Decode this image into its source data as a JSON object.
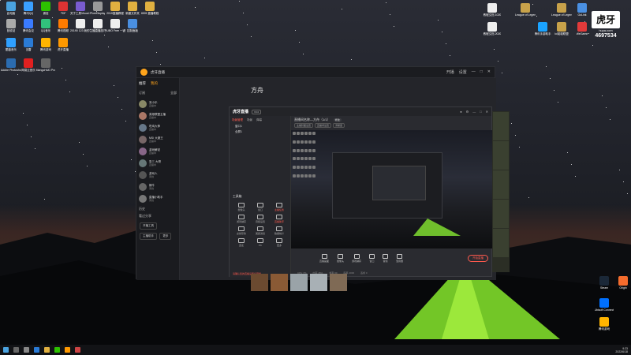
{
  "overlay": {
    "logo": "虎牙",
    "sub": "huya.com",
    "room_number": "4697534"
  },
  "desktop_left_icons": [
    {
      "label": "此电脑",
      "color": "#4aa3e0"
    },
    {
      "label": "腾讯QQ",
      "color": "#3aa0ff"
    },
    {
      "label": "微信",
      "color": "#2dc100"
    },
    {
      "label": "PDF",
      "color": "#d33"
    },
    {
      "label": "关于工具Visual Studio",
      "color": "#7a5cd0"
    },
    {
      "label": "PureDisplay",
      "color": "#999"
    },
    {
      "label": "2019直播教程",
      "color": "#e0b040"
    },
    {
      "label": "新建文件夹",
      "color": "#e0b040"
    },
    {
      "label": "4595 直播教程",
      "color": "#e0b040"
    },
    {
      "label": "回收站",
      "color": "#aaa"
    },
    {
      "label": "腾讯会议",
      "color": "#3a7bff"
    },
    {
      "label": "QQ音乐",
      "color": "#31c27c"
    },
    {
      "label": "腾讯视频",
      "color": "#ff7b00"
    },
    {
      "label": "20190 123 我的下载",
      "color": "#eee"
    },
    {
      "label": "主播直播技巧",
      "color": "#eee"
    },
    {
      "label": "YUBO Free 一键换",
      "color": "#eee"
    },
    {
      "label": "控制面板",
      "color": "#4a8fe0"
    },
    {
      "label": "酷狗音乐",
      "color": "#2fa0ff"
    },
    {
      "label": "迅雷",
      "color": "#2a7bd6"
    },
    {
      "label": "腾讯游戏",
      "color": "#ffb400"
    },
    {
      "label": "虎牙直播",
      "color": "#ff9900"
    },
    {
      "label": "Adobe Photoshop",
      "color": "#2b6cb0"
    },
    {
      "label": "网易云音乐",
      "color": "#e02020"
    },
    {
      "label": "MangoHUD Pro",
      "color": "#666"
    }
  ],
  "desktop_right_icons": [
    {
      "label": "教程文档 1020",
      "color": "#eee"
    },
    {
      "label": "League of Legends",
      "color": "#c8a24a"
    },
    {
      "label": "League of Legends",
      "color": "#c8a24a"
    },
    {
      "label": "GoLink",
      "color": "#4a90e2"
    },
    {
      "label": "教程文档 2020",
      "color": "#eee"
    },
    {
      "label": "腾讯手游助手",
      "color": "#1aa3ff"
    },
    {
      "label": "lol英雄联盟",
      "color": "#c8a24a"
    },
    {
      "label": "WeGame",
      "color": "#e23a3a"
    },
    {
      "label": "Steam",
      "color": "#1b2838"
    },
    {
      "label": "Origin",
      "color": "#f56c2d"
    },
    {
      "label": "Ubisoft Connect",
      "color": "#0070ff"
    },
    {
      "label": "腾讯游戏",
      "color": "#ffb400"
    }
  ],
  "app": {
    "title": "虎牙直播",
    "window_controls": [
      "开播",
      "设置",
      "—",
      "□",
      "✕"
    ],
    "tabs": [
      "推荐",
      "我的"
    ],
    "sections": {
      "subscribed": "订阅",
      "more": "全部"
    },
    "anchors": [
      {
        "name": "安小乐",
        "status": "直播中"
      },
      {
        "name": "英雄联盟主播",
        "status": "直播中"
      },
      {
        "name": "吃鸡大神",
        "status": "直播中"
      },
      {
        "name": "MSI 大魔王",
        "status": "直播中"
      },
      {
        "name": "游戏解说",
        "status": "直播中"
      },
      {
        "name": "张三 大哥",
        "status": "直播中"
      },
      {
        "name": "游戏人",
        "status": "离线"
      },
      {
        "name": "蜗牛",
        "status": "离线"
      },
      {
        "name": "直播小助手",
        "status": "离线"
      }
    ],
    "side_footer": {
      "history": "历史",
      "my_tasks": "看过分享",
      "btn1": "开播工具",
      "btn2": "主播助手",
      "btn3": "更多"
    },
    "channel_title": "方舟"
  },
  "studio": {
    "logo": "虎牙直播",
    "version": "V3.0",
    "tabs": [
      "场景管理",
      "场景",
      "弹幕"
    ],
    "scenes": [
      "窗口1",
      "全屏1"
    ],
    "toolbox_title": "工具箱",
    "tools": [
      {
        "label": "摄像头",
        "red": false
      },
      {
        "label": "窗口",
        "red": false
      },
      {
        "label": "主播任务",
        "red": true
      },
      {
        "label": "游戏捕获",
        "red": false
      },
      {
        "label": "音频设置",
        "red": false
      },
      {
        "label": "直播助手",
        "red": true
      },
      {
        "label": "虚拟形象",
        "red": false
      },
      {
        "label": "美颜滤镜",
        "red": false
      },
      {
        "label": "数据统计",
        "red": false
      },
      {
        "label": "连麦",
        "red": false
      },
      {
        "label": "PK",
        "red": false
      },
      {
        "label": "更多",
        "red": false
      }
    ],
    "notice": "请确认您的直播设置后开播",
    "live_title": "直播间名称—方舟（1/1）",
    "live_tag": "修改",
    "sub_pills": [
      "主播封面设置",
      "直播间设置",
      "清晰度"
    ],
    "controls": [
      "直播画面",
      "摄像头",
      "游戏捕获",
      "窗口",
      "音频",
      "混音器"
    ],
    "start_label": "开始直播",
    "bottom": [
      "CPU 7%",
      "内存 45%",
      "帧率 60",
      "码率 4000",
      "丢帧 0"
    ]
  },
  "taskbar": {
    "time": "9:23",
    "date": "2022/6/18"
  }
}
